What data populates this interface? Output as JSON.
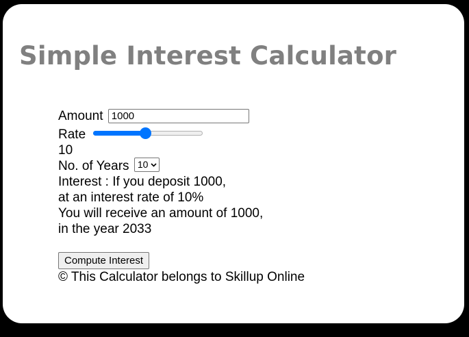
{
  "title": "Simple Interest Calculator",
  "amount": {
    "label": "Amount",
    "value": "1000"
  },
  "rate": {
    "label": "Rate",
    "value": "10",
    "slider_fraction": 0.47,
    "accent_color": "#0075ff"
  },
  "years": {
    "label": "No. of Years",
    "selected": "10"
  },
  "result": {
    "line1": "Interest : If you deposit 1000,",
    "line2": "at an interest rate of 10%",
    "line3": "You will receive an amount of 1000,",
    "line4": "in the year 2033"
  },
  "compute_button": "Compute Interest",
  "footer": "© This Calculator belongs to Skillup Online",
  "colors": {
    "title": "#808080",
    "background": "#000000",
    "card": "#ffffff"
  }
}
